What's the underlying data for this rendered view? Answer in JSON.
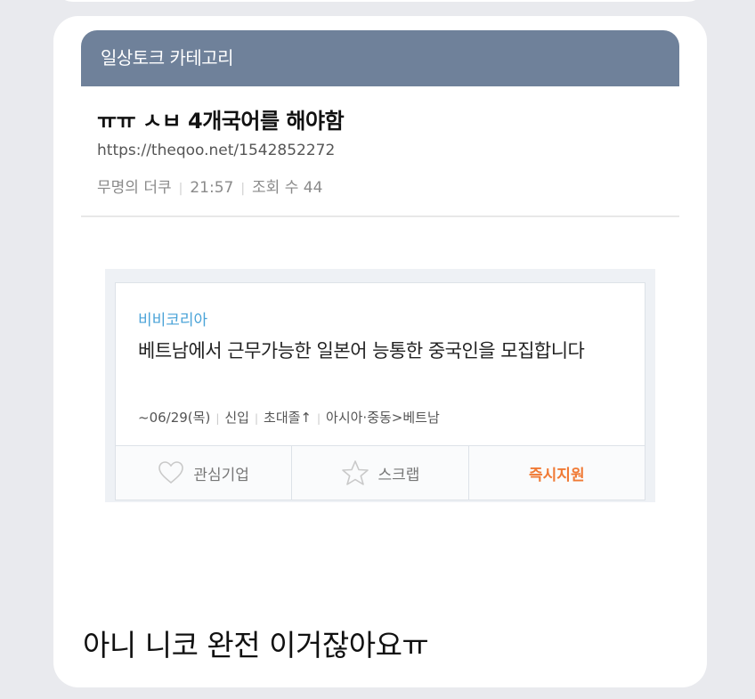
{
  "post": {
    "category": "일상토크 카테고리",
    "title": "ㅠㅠ ㅅㅂ 4개국어를 해야함",
    "url": "https://theqoo.net/1542852272",
    "author": "무명의 더쿠",
    "time": "21:57",
    "views": "조회 수 44"
  },
  "job": {
    "company": "비비코리아",
    "title": "베트남에서 근무가능한 일본어 능통한 중국인을 모집합니다",
    "deadline": "~06/29(목)",
    "career": "신입",
    "education": "초대졸↑",
    "location": "아시아·중동>베트남",
    "actions": {
      "interest": "관심기업",
      "scrap": "스크랩",
      "apply": "즉시지원"
    }
  },
  "message": "아니 니코 완전 이거잖아요ㅠ",
  "colors": {
    "category_bar": "#6f819a",
    "company": "#4aa3d8",
    "apply": "#f07a35",
    "background": "#e9eaee"
  }
}
